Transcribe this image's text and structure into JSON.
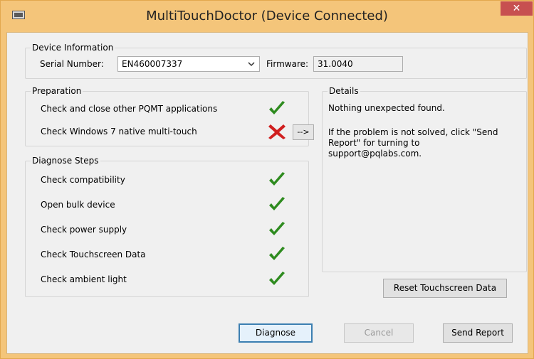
{
  "window": {
    "title": "MultiTouchDoctor (Device Connected)",
    "close_glyph": "✕"
  },
  "device_info": {
    "legend": "Device Information",
    "serial_label": "Serial Number:",
    "serial_value": "EN460007337",
    "firmware_label": "Firmware:",
    "firmware_value": "31.0040"
  },
  "preparation": {
    "legend": "Preparation",
    "items": [
      {
        "label": "Check and close other PQMT applications",
        "status": "ok",
        "icon": "checkmark-icon"
      },
      {
        "label": "Check Windows 7 native multi-touch",
        "status": "fail",
        "icon": "x-mark-icon"
      }
    ],
    "arrow_button_label": "-->"
  },
  "diagnose": {
    "legend": "Diagnose Steps",
    "items": [
      {
        "label": "Check compatibility",
        "status": "ok"
      },
      {
        "label": "Open bulk device",
        "status": "ok"
      },
      {
        "label": "Check power supply",
        "status": "ok"
      },
      {
        "label": "Check Touchscreen Data",
        "status": "ok"
      },
      {
        "label": "Check ambient light",
        "status": "ok"
      }
    ]
  },
  "details": {
    "legend": "Details",
    "line1": "Nothing unexpected found.",
    "line2": "If the problem is not solved, click \"Send",
    "line3": "Report\" for turning to",
    "line4": "support@pqlabs.com."
  },
  "buttons": {
    "reset": "Reset Touchscreen Data",
    "diagnose": "Diagnose",
    "cancel": "Cancel",
    "send_report": "Send Report"
  },
  "colors": {
    "title_bar": "#f4c57a",
    "close_button": "#c75050",
    "check_green": "#2e8b1f",
    "x_red": "#d01f1f",
    "default_button_border": "#3c7fb1"
  }
}
